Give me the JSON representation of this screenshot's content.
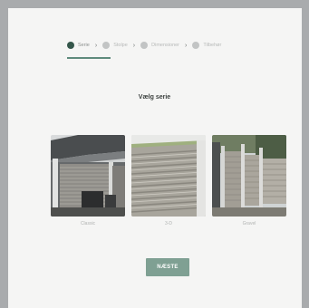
{
  "steps": [
    {
      "label": "Serie",
      "active": true
    },
    {
      "label": "Stolpe",
      "active": false
    },
    {
      "label": "Dimensioner",
      "active": false
    },
    {
      "label": "Tilbehør",
      "active": false
    }
  ],
  "heading": "Vælg serie",
  "options": [
    {
      "label": "Classic"
    },
    {
      "label": "3-D"
    },
    {
      "label": "Gravel"
    }
  ],
  "next_button": "NÆSTE",
  "colors": {
    "accent": "#34564a",
    "underline": "#5f8b7c",
    "button": "#7fa093"
  }
}
